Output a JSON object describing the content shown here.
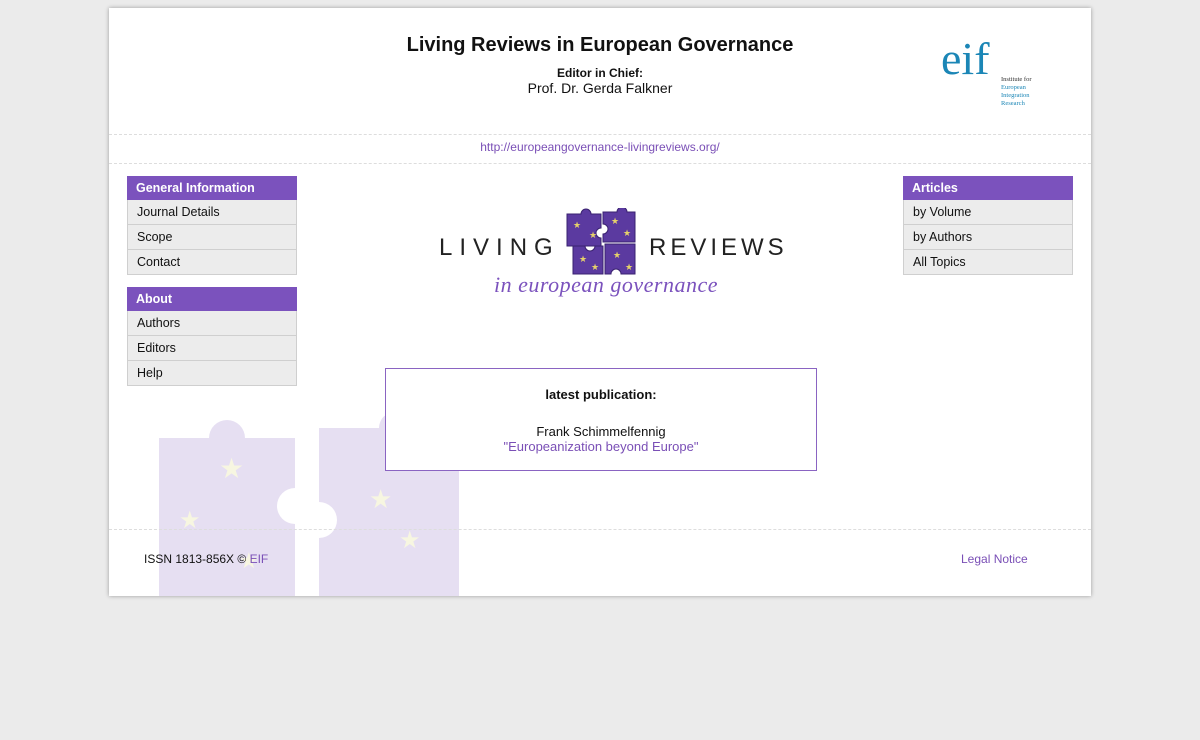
{
  "header": {
    "title": "Living Reviews in European Governance",
    "editor_label": "Editor in Chief:",
    "editor_name": "Prof. Dr. Gerda Falkner"
  },
  "eif_logo": {
    "mark": "eif",
    "lines": [
      "Institute for",
      "European",
      "Integration",
      "Research"
    ],
    "color": "#1b86b6"
  },
  "url": "http://europeangovernance-livingreviews.org/",
  "left_menus": [
    {
      "heading": "General Information",
      "items": [
        "Journal Details",
        "Scope",
        "Contact"
      ]
    },
    {
      "heading": "About",
      "items": [
        "Authors",
        "Editors",
        "Help"
      ]
    }
  ],
  "right_menu": {
    "heading": "Articles",
    "items": [
      "by Volume",
      "by Authors",
      "All Topics"
    ]
  },
  "center_logo": {
    "word_left": "LIVING",
    "word_right": "REVIEWS",
    "subtitle": "in european governance"
  },
  "latest": {
    "heading": "latest publication:",
    "author": "Frank Schimmelfennig",
    "title": "\"Europeanization beyond Europe\""
  },
  "footer": {
    "issn": "ISSN 1813-856X © ",
    "issn_link": "EIF",
    "legal": "Legal Notice"
  },
  "colors": {
    "accent": "#7b52bd",
    "link": "#7a4fb6",
    "page_bg": "#ebebeb"
  }
}
